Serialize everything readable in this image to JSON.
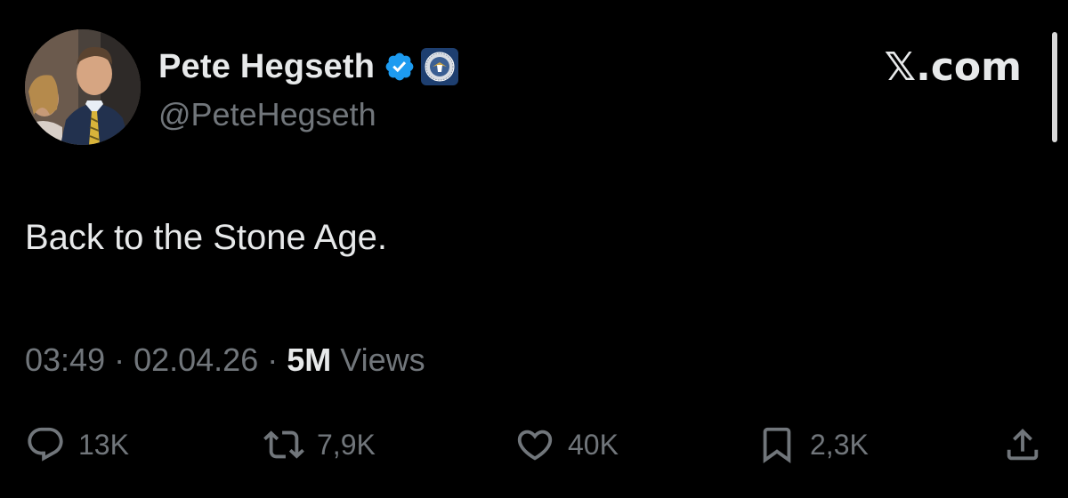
{
  "author": {
    "display_name": "Pete Hegseth",
    "handle": "@PeteHegseth",
    "verified_icon": "verified-badge-icon",
    "affiliation_icon": "dod-seal-icon"
  },
  "site": "𝕏.com",
  "tweet": {
    "text": "Back to the Stone Age."
  },
  "meta": {
    "time": "03:49",
    "sep1": " · ",
    "date": "02.04.26",
    "sep2": " · ",
    "views_count": "5M",
    "views_label": " Views"
  },
  "actions": {
    "reply": {
      "icon": "reply-icon",
      "count": "13K"
    },
    "repost": {
      "icon": "repost-icon",
      "count": "7,9K"
    },
    "like": {
      "icon": "heart-icon",
      "count": "40K"
    },
    "bookmark": {
      "icon": "bookmark-icon",
      "count": "2,3K"
    },
    "share": {
      "icon": "share-icon"
    }
  },
  "colors": {
    "background": "#000000",
    "primary_text": "#e7e9ea",
    "secondary_text": "#71767b",
    "verified_blue": "#1d9bf0"
  }
}
